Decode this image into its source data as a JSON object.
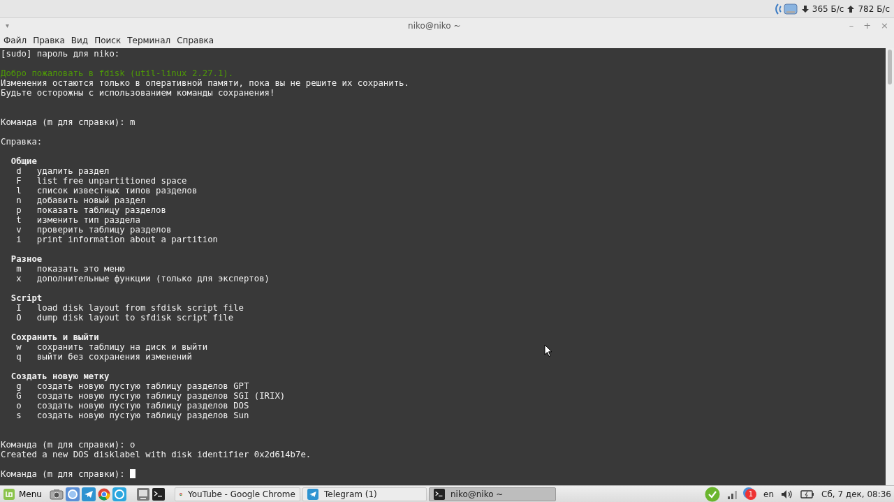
{
  "top_panel": {
    "download": "365 Б/с",
    "upload": "782 Б/с"
  },
  "window": {
    "title": "niko@niko ~",
    "menu_glyph": "▾",
    "controls": [
      "–",
      "+",
      "×"
    ]
  },
  "menu": [
    "Файл",
    "Правка",
    "Вид",
    "Поиск",
    "Терминал",
    "Справка"
  ],
  "terminal": {
    "lines": [
      {
        "kind": "text",
        "text": "[sudo] пароль для niko:"
      },
      {
        "kind": "blank"
      },
      {
        "kind": "green",
        "text": "Добро пожаловать в fdisk (util-linux 2.27.1)."
      },
      {
        "kind": "text",
        "text": "Изменения остаются только в оперативной памяти, пока вы не решите их сохранить."
      },
      {
        "kind": "text",
        "text": "Будьте осторожны с использованием команды сохранения!"
      },
      {
        "kind": "blank"
      },
      {
        "kind": "blank"
      },
      {
        "kind": "text",
        "text": "Команда (m для справки): m"
      },
      {
        "kind": "blank"
      },
      {
        "kind": "text",
        "text": "Справка:"
      },
      {
        "kind": "blank"
      },
      {
        "kind": "heading",
        "text": "  Общие"
      },
      {
        "kind": "text",
        "text": "   d   удалить раздел"
      },
      {
        "kind": "text",
        "text": "   F   list free unpartitioned space"
      },
      {
        "kind": "text",
        "text": "   l   список известных типов разделов"
      },
      {
        "kind": "text",
        "text": "   n   добавить новый раздел"
      },
      {
        "kind": "text",
        "text": "   p   показать таблицу разделов"
      },
      {
        "kind": "text",
        "text": "   t   изменить тип раздела"
      },
      {
        "kind": "text",
        "text": "   v   проверить таблицу разделов"
      },
      {
        "kind": "text",
        "text": "   i   print information about a partition"
      },
      {
        "kind": "blank"
      },
      {
        "kind": "heading",
        "text": "  Разное"
      },
      {
        "kind": "text",
        "text": "   m   показать это меню"
      },
      {
        "kind": "text",
        "text": "   x   дополнительные функции (только для экспертов)"
      },
      {
        "kind": "blank"
      },
      {
        "kind": "heading",
        "text": "  Script"
      },
      {
        "kind": "text",
        "text": "   I   load disk layout from sfdisk script file"
      },
      {
        "kind": "text",
        "text": "   O   dump disk layout to sfdisk script file"
      },
      {
        "kind": "blank"
      },
      {
        "kind": "heading",
        "text": "  Сохранить и выйти"
      },
      {
        "kind": "text",
        "text": "   w   сохранить таблицу на диск и выйти"
      },
      {
        "kind": "text",
        "text": "   q   выйти без сохранения изменений"
      },
      {
        "kind": "blank"
      },
      {
        "kind": "heading",
        "text": "  Создать новую метку"
      },
      {
        "kind": "text",
        "text": "   g   создать новую пустую таблицу разделов GPT"
      },
      {
        "kind": "text",
        "text": "   G   создать новую пустую таблицу разделов SGI (IRIX)"
      },
      {
        "kind": "text",
        "text": "   o   создать новую пустую таблицу разделов DOS"
      },
      {
        "kind": "text",
        "text": "   s   создать новую пустую таблицу разделов Sun"
      },
      {
        "kind": "blank"
      },
      {
        "kind": "blank"
      },
      {
        "kind": "text",
        "text": "Команда (m для справки): o"
      },
      {
        "kind": "text",
        "text": "Created a new DOS disklabel with disk identifier 0x2d614b7e."
      },
      {
        "kind": "blank"
      },
      {
        "kind": "prompt",
        "text": "Команда (m для справки): "
      }
    ]
  },
  "taskbar": {
    "menu_label": "Menu",
    "windows": [
      {
        "label": "YouTube - Google Chrome",
        "selected": false
      },
      {
        "label": "Telegram (1)",
        "selected": false
      },
      {
        "label": "niko@niko ~",
        "selected": true
      }
    ],
    "notification_count": "1",
    "keyboard_layout": "en",
    "clock": "Сб, 7 дек, 08:36"
  }
}
